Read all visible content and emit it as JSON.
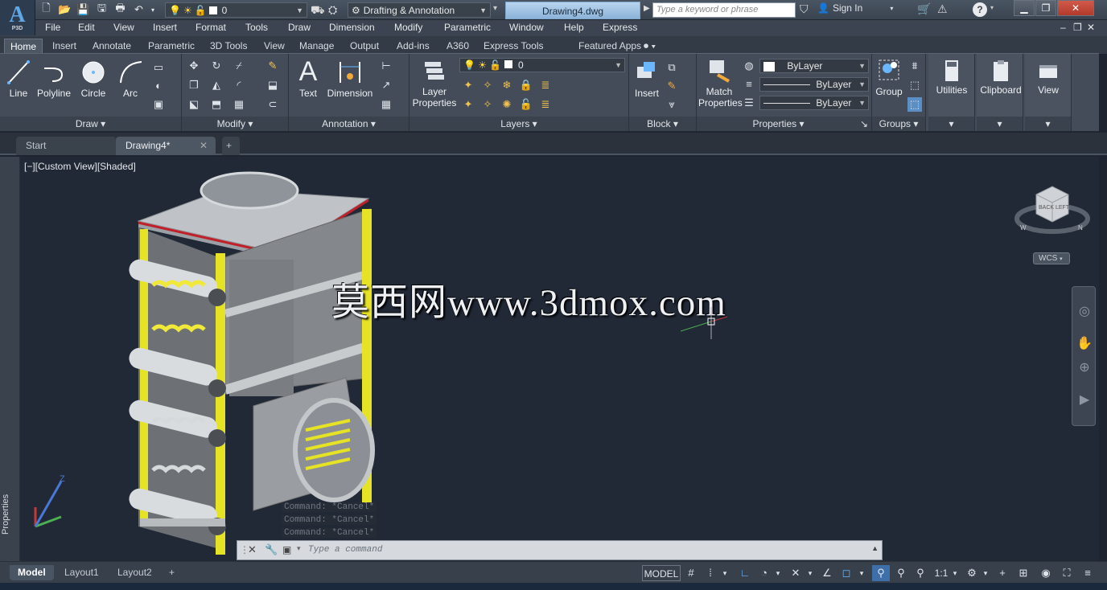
{
  "app": {
    "logo_letter": "A",
    "logo_sub": "P3D"
  },
  "titlebar": {
    "layer_value": "0",
    "workspace": "Drafting & Annotation",
    "doc_title": "Drawing4.dwg",
    "search_placeholder": "Type a keyword or phrase",
    "signin": "Sign In",
    "help": "?"
  },
  "menu": [
    "File",
    "Edit",
    "View",
    "Insert",
    "Format",
    "Tools",
    "Draw",
    "Dimension",
    "Modify",
    "Parametric",
    "Window",
    "Help",
    "Express"
  ],
  "ribbon_tabs": [
    "Home",
    "Insert",
    "Annotate",
    "Parametric",
    "3D Tools",
    "View",
    "Manage",
    "Output",
    "Add-ins",
    "A360",
    "Express Tools",
    "Featured Apps"
  ],
  "ribbon": {
    "draw": {
      "title": "Draw",
      "line": "Line",
      "polyline": "Polyline",
      "circle": "Circle",
      "arc": "Arc"
    },
    "modify": {
      "title": "Modify"
    },
    "annotation": {
      "title": "Annotation",
      "text": "Text",
      "dimension": "Dimension"
    },
    "layers": {
      "title": "Layers",
      "layer_properties_1": "Layer",
      "layer_properties_2": "Properties",
      "current_layer": "0"
    },
    "block": {
      "title": "Block",
      "insert": "Insert"
    },
    "properties": {
      "title": "Properties",
      "match_1": "Match",
      "match_2": "Properties",
      "color": "ByLayer",
      "linetype": "ByLayer",
      "lineweight": "ByLayer"
    },
    "groups": {
      "title": "Groups",
      "group": "Group"
    },
    "utilities": "Utilities",
    "clipboard": "Clipboard",
    "view": "View"
  },
  "file_tabs": {
    "start": "Start",
    "drawing": "Drawing4*",
    "new": "+"
  },
  "viewport": {
    "label": "[−][Custom View][Shaded]",
    "watermark": "莫西网www.3dmox.com",
    "wcs": "WCS",
    "properties_palette": "Properties",
    "viewcube_back": "BACK",
    "viewcube_left": "LEFT",
    "compass_w": "W",
    "compass_n": "N",
    "axis_z": "Z"
  },
  "command": {
    "history": [
      "Command: *Cancel*",
      "Command: *Cancel*",
      "Command: *Cancel*"
    ],
    "placeholder": "Type a command"
  },
  "status": {
    "layouts": [
      "Model",
      "Layout1",
      "Layout2"
    ],
    "model": "MODEL",
    "scale": "1:1"
  }
}
